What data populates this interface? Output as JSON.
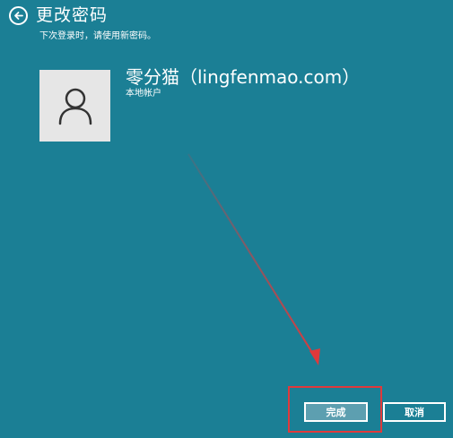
{
  "header": {
    "title": "更改密码",
    "subtitle": "下次登录时，请使用新密码。"
  },
  "account": {
    "name": "零分猫（lingfenmao.com）",
    "type": "本地帐户"
  },
  "buttons": {
    "done": "完成",
    "cancel": "取消"
  },
  "colors": {
    "background": "#1b7f95",
    "done_button": "#5d9fb0",
    "annotation": "#e0393b"
  },
  "icons": {
    "back": "back-arrow-icon",
    "avatar": "user-silhouette-icon"
  }
}
